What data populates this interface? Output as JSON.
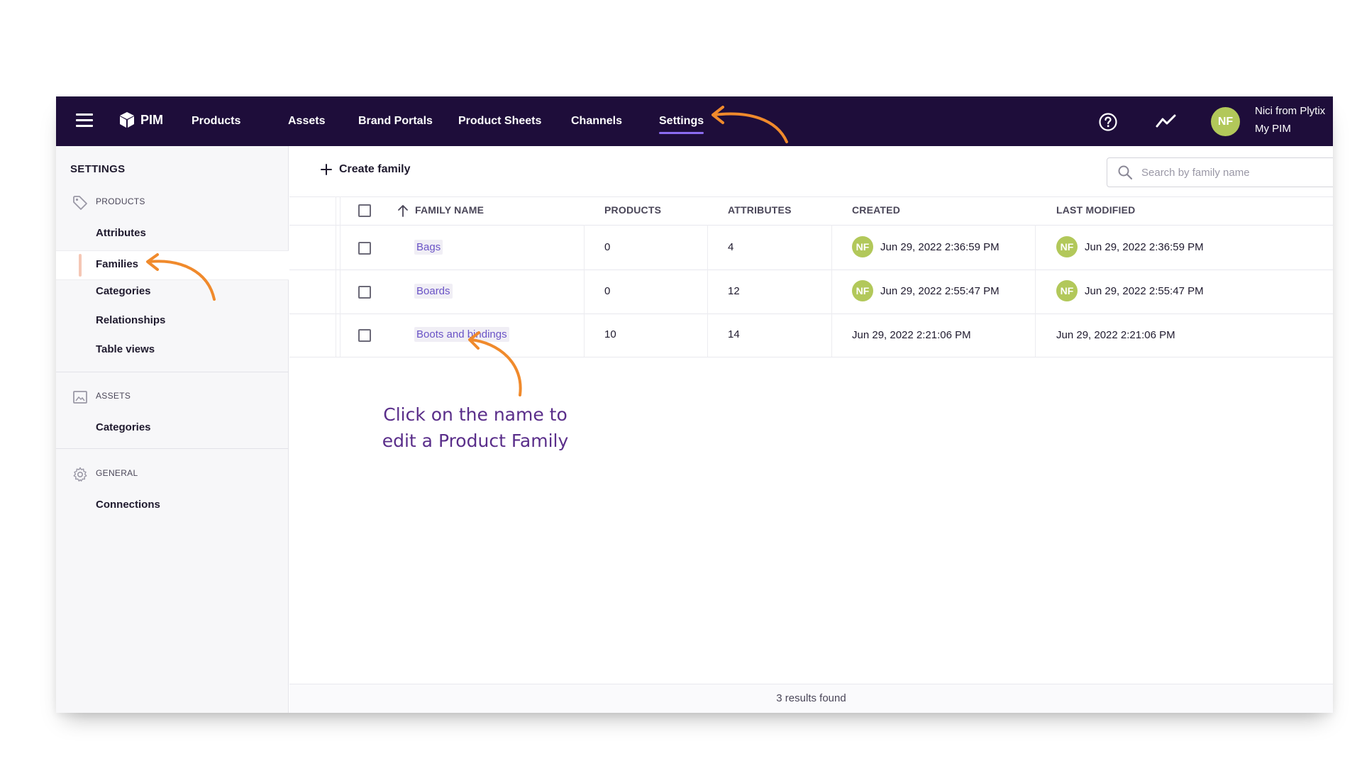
{
  "nav": {
    "app_name": "PIM",
    "items": [
      {
        "label": "Products"
      },
      {
        "label": "Assets"
      },
      {
        "label": "Brand Portals"
      },
      {
        "label": "Product Sheets"
      },
      {
        "label": "Channels"
      },
      {
        "label": "Settings",
        "active": true
      }
    ],
    "user": {
      "initials": "NF",
      "name": "Nici from Plytix",
      "org": "My PIM"
    }
  },
  "sidebar": {
    "title": "SETTINGS",
    "sections": [
      {
        "label": "PRODUCTS",
        "icon": "tag-icon",
        "items": [
          "Attributes",
          "Families",
          "Categories",
          "Relationships",
          "Table views"
        ],
        "active_item": "Families"
      },
      {
        "label": "ASSETS",
        "icon": "image-icon",
        "items": [
          "Categories"
        ]
      },
      {
        "label": "GENERAL",
        "icon": "gear-icon",
        "items": [
          "Connections"
        ]
      }
    ]
  },
  "toolbar": {
    "create_label": "Create family",
    "search_placeholder": "Search by family name"
  },
  "table": {
    "columns": [
      "FAMILY NAME",
      "PRODUCTS",
      "ATTRIBUTES",
      "CREATED",
      "LAST MODIFIED"
    ],
    "sort": {
      "column": "FAMILY NAME",
      "direction": "ascending"
    },
    "rows": [
      {
        "name": "Bags",
        "products": "0",
        "attributes": "4",
        "created_initials": "NF",
        "created": "Jun 29, 2022 2:36:59 PM",
        "modified_initials": "NF",
        "modified": "Jun 29, 2022 2:36:59 PM"
      },
      {
        "name": "Boards",
        "products": "0",
        "attributes": "12",
        "created_initials": "NF",
        "created": "Jun 29, 2022 2:55:47 PM",
        "modified_initials": "NF",
        "modified": "Jun 29, 2022 2:55:47 PM"
      },
      {
        "name": "Boots and bindings",
        "products": "10",
        "attributes": "14",
        "created": "Jun 29, 2022 2:21:06 PM",
        "modified": "Jun 29, 2022 2:21:06 PM"
      }
    ],
    "results_text": "3 results found"
  },
  "annotation": {
    "line1": "Click on the name to",
    "line2": "edit a Product Family"
  },
  "colors": {
    "nav_bg": "#1e0d3a",
    "accent": "#8c6cf0",
    "link": "#6a53c6",
    "avatar": "#b2c85a",
    "annotation_arrow": "#f08a2c",
    "annotation_text": "#5a2e8a"
  }
}
